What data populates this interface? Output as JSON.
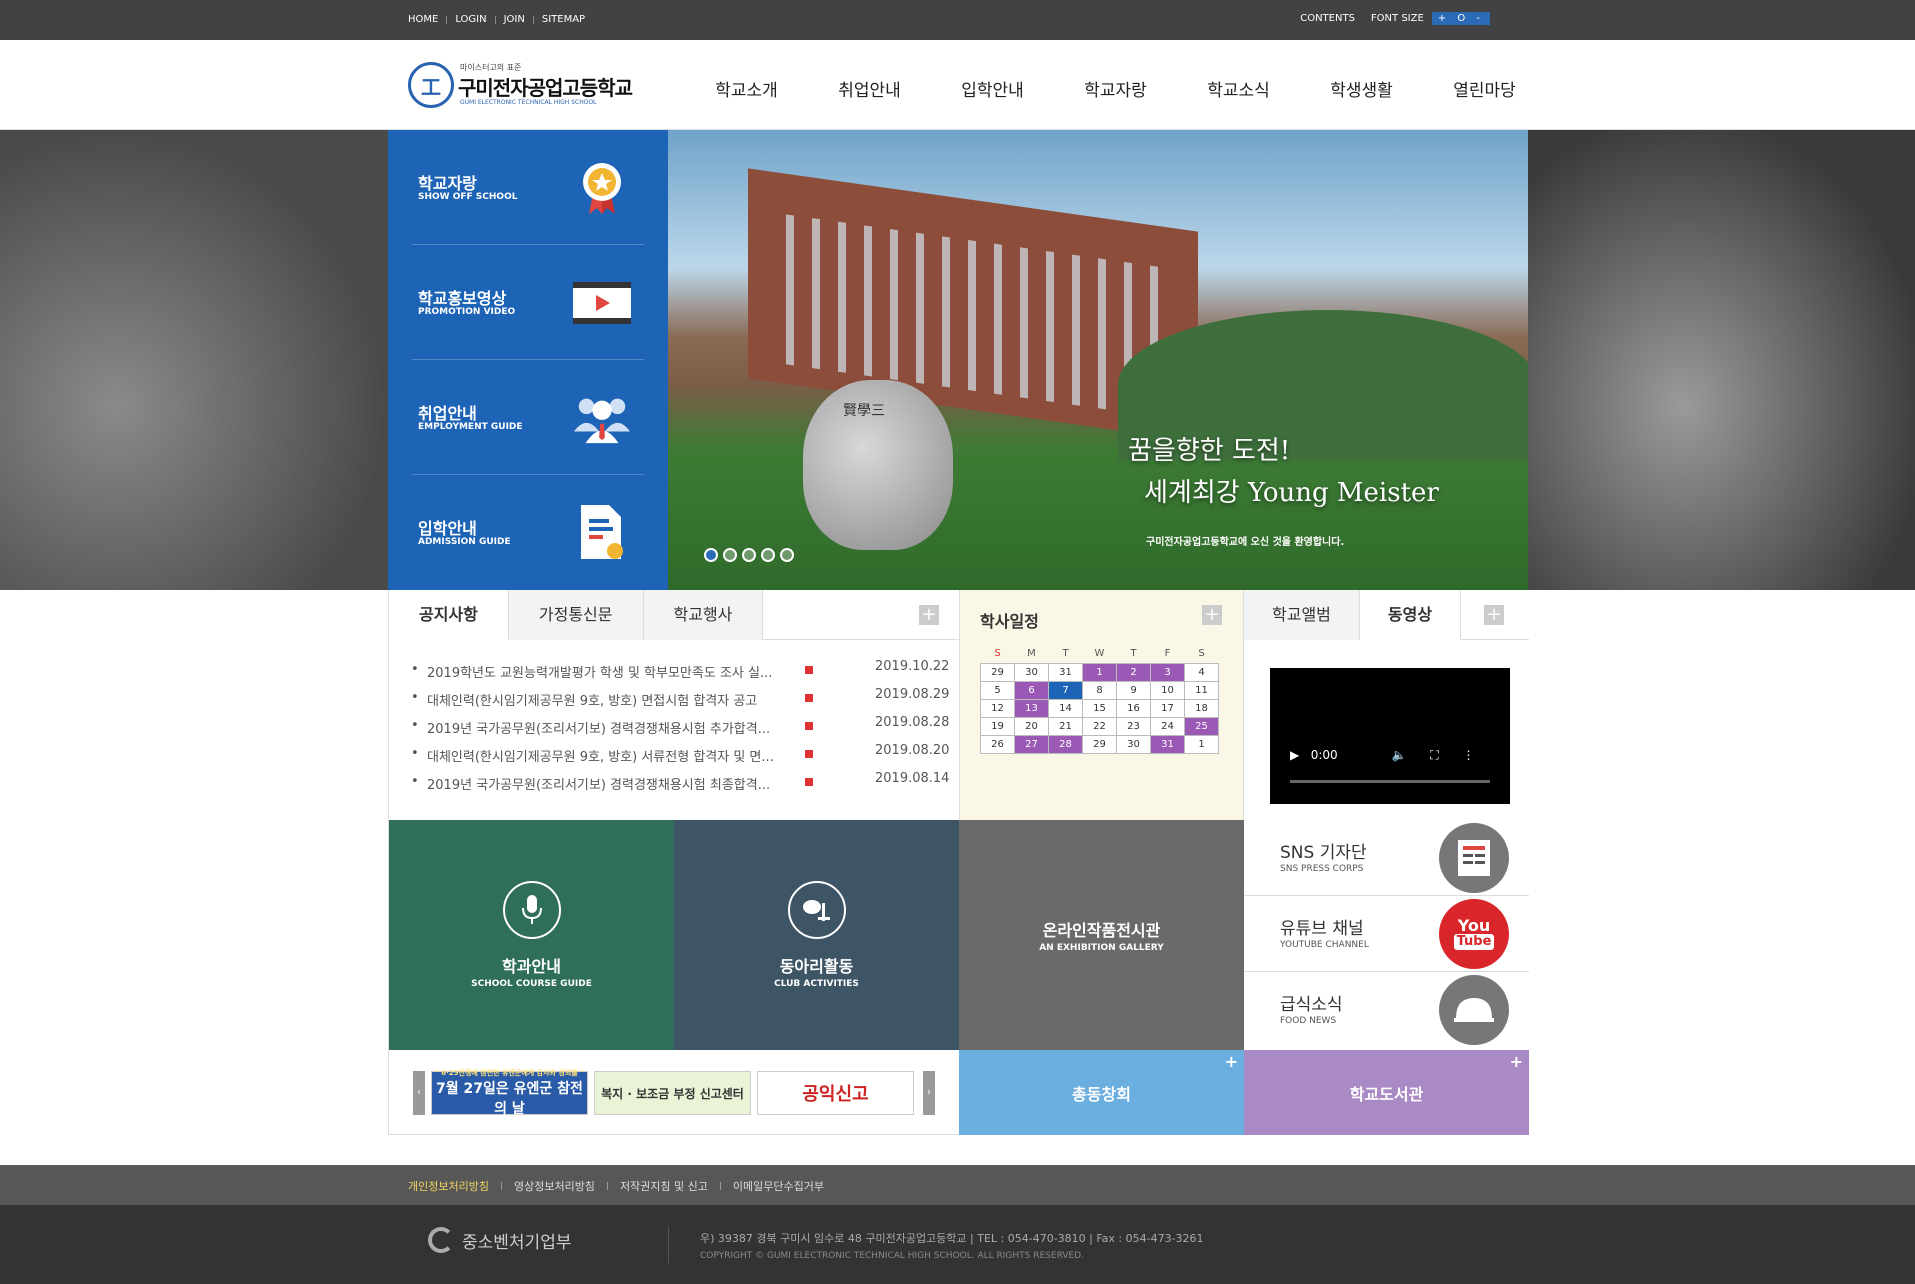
{
  "topbar": {
    "left_links": [
      "HOME",
      "LOGIN",
      "JOIN",
      "SITEMAP"
    ],
    "contents": "CONTENTS",
    "font_size": "FONT SIZE",
    "font_controls": "+ O -"
  },
  "logo": {
    "small": "마이스터고의 표준",
    "name": "구미전자공업고등학교",
    "eng": "GUMI ELECTRONIC TECHNICAL HIGH SCHOOL"
  },
  "gnb": [
    "학교소개",
    "취업안내",
    "입학안내",
    "학교자랑",
    "학교소식",
    "학생생활",
    "열린마당"
  ],
  "quick": [
    {
      "title": "학교자랑",
      "eng": "SHOW OFF SCHOOL",
      "icon": "medal-icon"
    },
    {
      "title": "학교홍보영상",
      "eng": "PROMOTION VIDEO",
      "icon": "video-icon"
    },
    {
      "title": "취업안내",
      "eng": "EMPLOYMENT GUIDE",
      "icon": "people-icon"
    },
    {
      "title": "입학안내",
      "eng": "ADMISSION GUIDE",
      "icon": "document-icon"
    }
  ],
  "slide": {
    "title1": "꿈을향한 도전!",
    "title2": "세계최강 Young Meister",
    "subtitle": "구미전자공업고등학교에 오신 것을 환영합니다.",
    "stone_text": "賢學三",
    "active_dot": 1,
    "dot_count": 5
  },
  "notice": {
    "tabs": [
      "공지사항",
      "가정통신문",
      "학교행사"
    ],
    "items": [
      {
        "text": "2019학년도 교원능력개발평가 학생 및 학부모만족도 조사 실...",
        "date": "2019.10.22"
      },
      {
        "text": "대체인력(한시임기제공무원 9호, 방호) 면접시험 합격자 공고",
        "date": "2019.08.29"
      },
      {
        "text": "2019년 국가공무원(조리서기보) 경력경쟁채용시험 추가합격...",
        "date": "2019.08.28"
      },
      {
        "text": "대체인력(한시임기제공무원 9호, 방호) 서류전형 합격자 및 면...",
        "date": "2019.08.20"
      },
      {
        "text": "2019년 국가공무원(조리서기보) 경력경쟁채용시험 최종합격...",
        "date": "2019.08.14"
      }
    ],
    "plus": "+"
  },
  "calendar": {
    "title": "학사일정",
    "days": [
      "S",
      "M",
      "T",
      "W",
      "T",
      "F",
      "S"
    ],
    "weeks": [
      [
        {
          "d": "29",
          "s": ""
        },
        {
          "d": "30",
          "s": ""
        },
        {
          "d": "31",
          "s": ""
        },
        {
          "d": "1",
          "s": "p"
        },
        {
          "d": "2",
          "s": "p"
        },
        {
          "d": "3",
          "s": "p"
        },
        {
          "d": "4",
          "s": ""
        }
      ],
      [
        {
          "d": "5",
          "s": ""
        },
        {
          "d": "6",
          "s": "p"
        },
        {
          "d": "7",
          "s": "b"
        },
        {
          "d": "8",
          "s": ""
        },
        {
          "d": "9",
          "s": ""
        },
        {
          "d": "10",
          "s": ""
        },
        {
          "d": "11",
          "s": ""
        }
      ],
      [
        {
          "d": "12",
          "s": ""
        },
        {
          "d": "13",
          "s": "p"
        },
        {
          "d": "14",
          "s": ""
        },
        {
          "d": "15",
          "s": ""
        },
        {
          "d": "16",
          "s": ""
        },
        {
          "d": "17",
          "s": ""
        },
        {
          "d": "18",
          "s": ""
        }
      ],
      [
        {
          "d": "19",
          "s": ""
        },
        {
          "d": "20",
          "s": ""
        },
        {
          "d": "21",
          "s": ""
        },
        {
          "d": "22",
          "s": ""
        },
        {
          "d": "23",
          "s": ""
        },
        {
          "d": "24",
          "s": ""
        },
        {
          "d": "25",
          "s": "p"
        }
      ],
      [
        {
          "d": "26",
          "s": ""
        },
        {
          "d": "27",
          "s": "p"
        },
        {
          "d": "28",
          "s": "p"
        },
        {
          "d": "29",
          "s": ""
        },
        {
          "d": "30",
          "s": ""
        },
        {
          "d": "31",
          "s": "p"
        },
        {
          "d": "1",
          "s": ""
        }
      ]
    ]
  },
  "video": {
    "tabs": [
      "학교앨범",
      "동영상"
    ],
    "time": "0:00"
  },
  "tiles": [
    {
      "title": "학과안내",
      "eng": "SCHOOL COURSE GUIDE",
      "icon": "microphone-icon",
      "color": "#2f6e5a"
    },
    {
      "title": "동아리활동",
      "eng": "CLUB ACTIVITIES",
      "icon": "projector-icon",
      "color": "#3e5566"
    },
    {
      "title": "온라인작품전시관",
      "eng": "AN EXHIBITION GALLERY",
      "icon": "gallery-icon",
      "color": "#6a6a6a"
    }
  ],
  "side_links": [
    {
      "title": "SNS 기자단",
      "eng": "SNS PRESS CORPS",
      "icon": "news-icon"
    },
    {
      "title": "유튜브 채널",
      "eng": "YOUTUBE CHANNEL",
      "icon": "youtube-icon",
      "badge1": "You",
      "badge2": "Tube"
    },
    {
      "title": "급식소식",
      "eng": "FOOD NEWS",
      "icon": "food-dome-icon"
    }
  ],
  "banners": [
    {
      "top": "\" 6·25전쟁에 참전한 유엔군에게 감사와 경의를 \"",
      "main": "7월 27일은 유엔군 참전의 날"
    },
    {
      "main": "복지 · 보조금 부정 신고센터"
    },
    {
      "main": "공익신고"
    }
  ],
  "bigbuttons": [
    {
      "label": "총동창회",
      "color": "#6baee0"
    },
    {
      "label": "학교도서관",
      "color": "#a98ac4"
    }
  ],
  "footer_links": [
    "개인정보처리방침",
    "영상정보처리방침",
    "저작권지침 및 신고",
    "이메일무단수집거부"
  ],
  "footer": {
    "logo": "중소벤처기업부",
    "address": "우) 39387 경북 구미시 임수로 48 구미전자공업고등학교   |   TEL : 054-470-3810   |   Fax : 054-473-3261",
    "copyright": "COPYRIGHT © GUMI ELECTRONIC TECHNICAL HIGH SCHOOL. ALL RIGHTS RESERVED."
  }
}
